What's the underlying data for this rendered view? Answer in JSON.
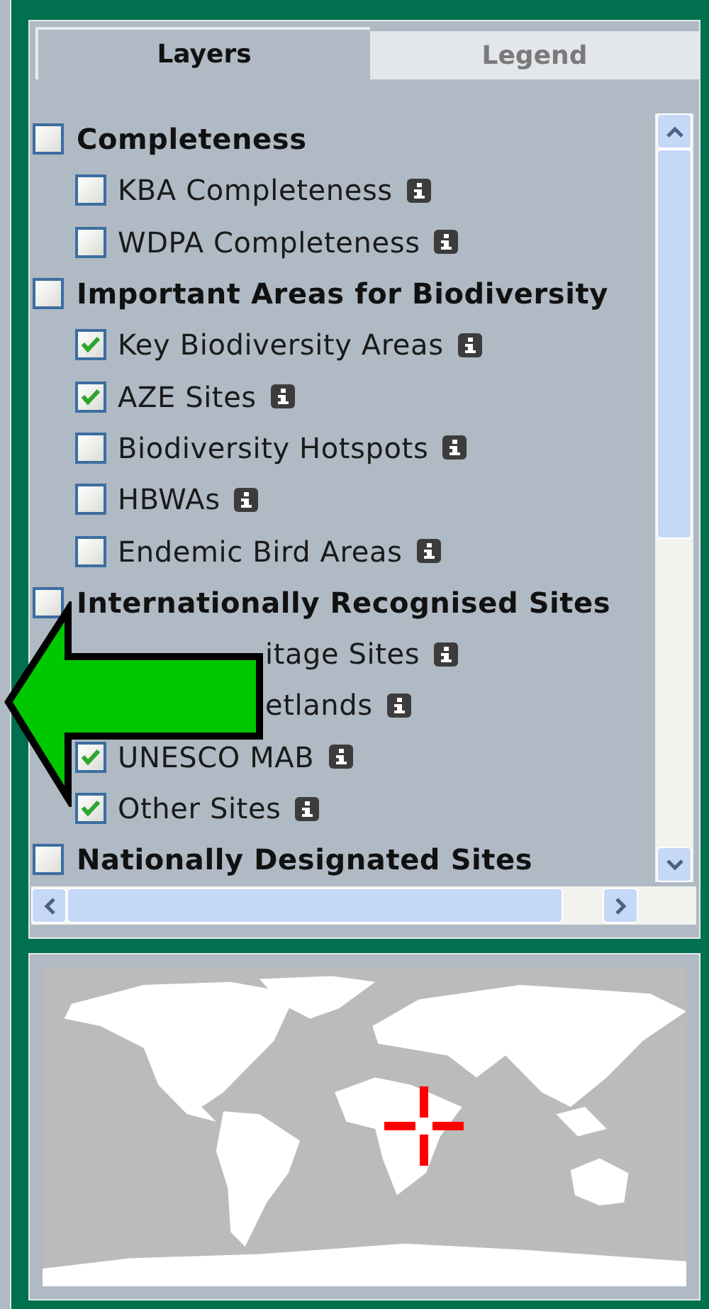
{
  "tabs": [
    {
      "label": "Layers",
      "selected": true
    },
    {
      "label": "Legend",
      "selected": false
    }
  ],
  "groups": [
    {
      "label": "Completeness",
      "checked": false,
      "children": [
        {
          "kind": "layer",
          "label": "KBA Completeness",
          "checked": false
        },
        {
          "kind": "layer",
          "label": "WDPA Completeness",
          "checked": false
        }
      ]
    },
    {
      "label": "Important Areas for Biodiversity",
      "checked": false,
      "children": [
        {
          "kind": "layer",
          "label": "Key Biodiversity Areas",
          "checked": true
        },
        {
          "kind": "layer",
          "label": "AZE Sites",
          "checked": true
        },
        {
          "kind": "layer",
          "label": "Biodiversity Hotspots",
          "checked": false
        },
        {
          "kind": "layer",
          "label": "HBWAs",
          "checked": false
        },
        {
          "kind": "layer",
          "label": "Endemic Bird Areas",
          "checked": false
        }
      ]
    },
    {
      "label": "Internationally Recognised Sites",
      "checked": false,
      "children": [
        {
          "kind": "covered",
          "label": "itage Sites"
        },
        {
          "kind": "covered",
          "label": "etlands"
        },
        {
          "kind": "layer",
          "label": "UNESCO MAB",
          "checked": true
        },
        {
          "kind": "layer",
          "label": "Other Sites",
          "checked": true
        }
      ]
    },
    {
      "label": "Nationally Designated Sites",
      "checked": false
    }
  ]
}
